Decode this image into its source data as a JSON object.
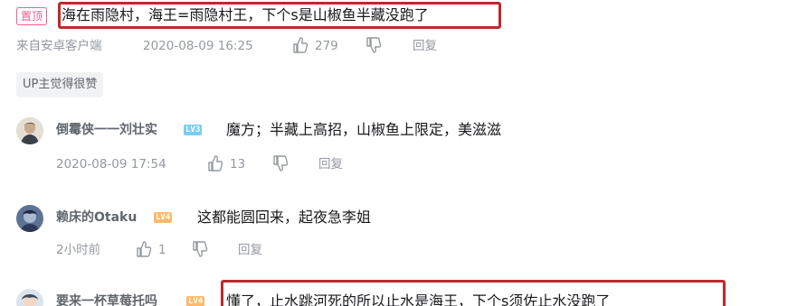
{
  "top_comment": {
    "pinned_label": "置顶",
    "text": "海在雨隐村，海王=雨隐村王，下个s是山椒鱼半藏没跑了",
    "source": "来自安卓客户端",
    "timestamp": "2020-08-09 16:25",
    "likes": "279",
    "reply_label": "回复",
    "up_tag": "UP主觉得很赞"
  },
  "replies": [
    {
      "username": "倒霉侠一一刘壮实",
      "level": "LV3",
      "level_color": "#7bcdef",
      "text": "魔方；半藏上高招，山椒鱼上限定，美滋滋",
      "timestamp": "2020-08-09 17:54",
      "likes": "13",
      "reply_label": "回复"
    },
    {
      "username": "赖床的Otaku",
      "level": "LV4",
      "level_color": "#feba6a",
      "text": "这都能圆回来，起夜急李姐",
      "timestamp": "2小时前",
      "likes": "1",
      "reply_label": "回复"
    },
    {
      "username": "要来一杯草莓托吗",
      "level": "LV4",
      "level_color": "#feba6a",
      "text": "懂了，止水跳河死的所以止水是海王，下个s须佐止水没跑了"
    }
  ],
  "colors": {
    "highlight": "#c0282d",
    "pinned": "#f25d8e"
  },
  "icons": {
    "like": "thumbs-up-icon",
    "dislike": "thumbs-down-icon"
  }
}
